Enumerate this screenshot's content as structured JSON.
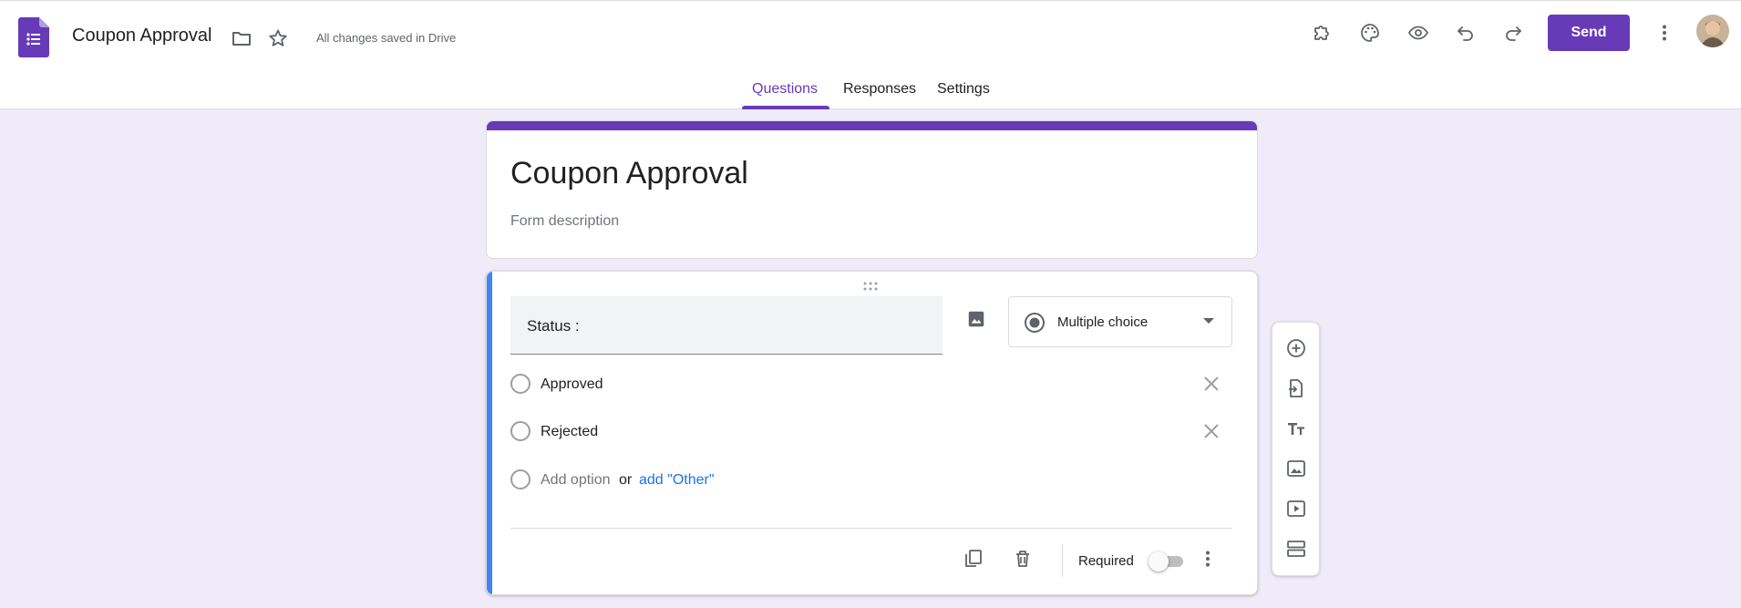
{
  "header": {
    "doc_title": "Coupon Approval",
    "saved_status": "All changes saved in Drive",
    "send_label": "Send",
    "icons": [
      "forms-app-icon",
      "folder-icon",
      "star-icon",
      "addon-icon",
      "palette-icon",
      "preview-eye-icon",
      "undo-icon",
      "redo-icon",
      "more-vert-icon"
    ]
  },
  "tabs": [
    {
      "label": "Questions",
      "active": true
    },
    {
      "label": "Responses",
      "active": false
    },
    {
      "label": "Settings",
      "active": false
    }
  ],
  "form": {
    "title": "Coupon Approval",
    "description_placeholder": "Form description"
  },
  "question": {
    "title": "Status :",
    "type": "Multiple choice",
    "options": [
      "Approved",
      "Rejected"
    ],
    "add_option": "Add option",
    "or": "or",
    "add_other": "add \"Other\"",
    "required_label": "Required",
    "required": false
  },
  "colors": {
    "accent": "#673ab7",
    "background": "#f0ebf8",
    "active_question_bar": "#4285f4",
    "link": "#1a73e8"
  },
  "side_toolbar": [
    "add-question-icon",
    "import-questions-icon",
    "add-title-icon",
    "add-image-icon",
    "add-video-icon",
    "add-section-icon"
  ]
}
